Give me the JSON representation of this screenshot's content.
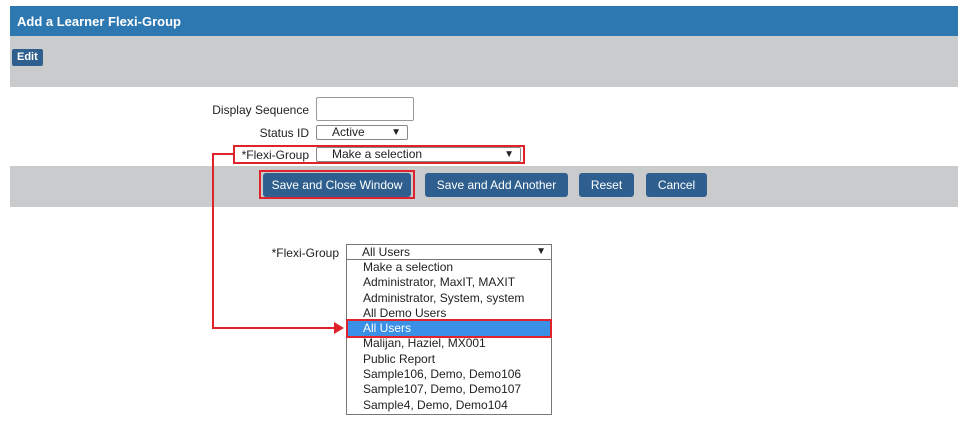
{
  "window": {
    "title": "Add a Learner Flexi-Group"
  },
  "toolbar": {
    "edit_label": "Edit"
  },
  "form": {
    "display_sequence_label": "Display Sequence",
    "display_sequence_value": "",
    "status_label": "Status ID",
    "status_value": "Active",
    "flexi_group_label": "*Flexi-Group",
    "flexi_group_value": "Make a selection"
  },
  "buttons": {
    "save_close": "Save and Close Window",
    "save_add": "Save and Add Another",
    "reset": "Reset",
    "cancel": "Cancel"
  },
  "dropdown_example": {
    "label": "*Flexi-Group",
    "selected": "All Users",
    "options": [
      "Make a selection",
      "Administrator, MaxIT, MAXIT",
      "Administrator, System, system",
      "All Demo Users",
      "All Users",
      "Malijan, Haziel, MX001",
      "Public Report",
      "Sample106, Demo, Demo106",
      "Sample107, Demo, Demo107",
      "Sample4, Demo, Demo104"
    ],
    "highlighted_option": "All Users"
  },
  "colors": {
    "title_bar": "#2e78b2",
    "button": "#2f5f8e",
    "highlight_red": "#e0222a",
    "selected_option": "#3a8fe6",
    "panel_gray": "#c9cbcd"
  },
  "icons": {
    "dropdown_arrow": "▼"
  }
}
